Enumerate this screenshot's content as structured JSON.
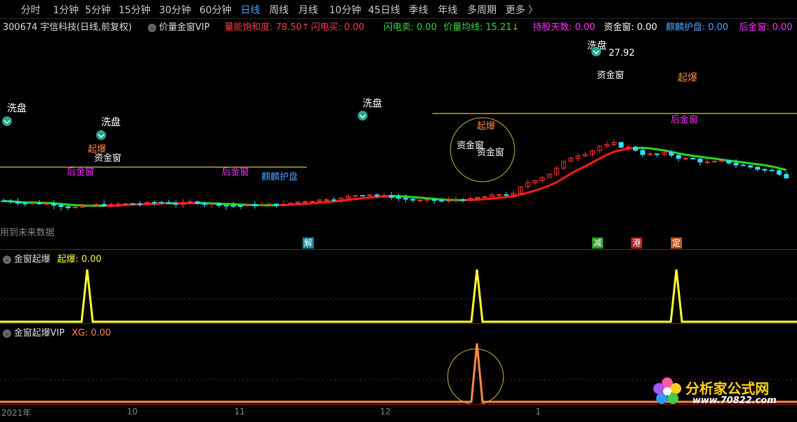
{
  "periods": [
    "分时",
    "1分钟",
    "5分钟",
    "15分钟",
    "30分钟",
    "60分钟",
    "日线",
    "周线",
    "月线",
    "10分钟",
    "45日线",
    "季线",
    "年线",
    "多周期",
    "更多 〉"
  ],
  "active_period": "日线",
  "stock": {
    "code_name": "300674 宇信科技(日线,前复权)",
    "indicator": "价量金窗VIP"
  },
  "info_items": [
    {
      "label": "量能饱和度:",
      "value": "78.50↑",
      "color": "#ff3b3b"
    },
    {
      "label": "闪电买:",
      "value": "0.00",
      "color": "#ff3b3b"
    },
    {
      "label": "闪电卖:",
      "value": "0.00",
      "color": "#33dd33"
    },
    {
      "label": "价量均线:",
      "value": "15.21↓",
      "color": "#33dd33"
    },
    {
      "label": "持股天数:",
      "value": "0.00",
      "color": "#ff33ff"
    },
    {
      "label": "资金窗:",
      "value": "0.00",
      "color": "#ffffff"
    },
    {
      "label": "麒麟护盘:",
      "value": "0.00",
      "color": "#4aa3ff"
    },
    {
      "label": "后金窗:",
      "value": "0.00",
      "color": "#ff33ff"
    }
  ],
  "chart_labels": {
    "xipan": "洗盘",
    "xipan_top": "洗盘",
    "price_high": "27.92",
    "zijinchuang": "资金窗",
    "qibao": "起爆",
    "houjinchuang": "后金窗",
    "qilinhupan": "麒麟护盘"
  },
  "watermark": "用到未来数据",
  "badges": [
    {
      "text": "解",
      "color": "#1a8a9a"
    },
    {
      "text": "减",
      "color": "#2a9a2a"
    },
    {
      "text": "港",
      "color": "#b02020"
    },
    {
      "text": "定",
      "color": "#c05a20"
    }
  ],
  "indicator1": {
    "name": "金窗起爆",
    "label": "起爆:",
    "value": "0.00"
  },
  "indicator2": {
    "name": "金窗起爆VIP",
    "label": "XG:",
    "value": "0.00"
  },
  "dates": [
    "2021年",
    "10",
    "11",
    "12",
    "1"
  ],
  "logo": {
    "title": "分析家公式网",
    "url": "www.70822.com"
  },
  "colors": {
    "up": "#ff3333",
    "down": "#33ddff",
    "ma_red": "#ff1a1a",
    "ma_green": "#22dd22",
    "yellow": "#ffff33",
    "orange": "#ff8844",
    "bg": "#000000"
  }
}
